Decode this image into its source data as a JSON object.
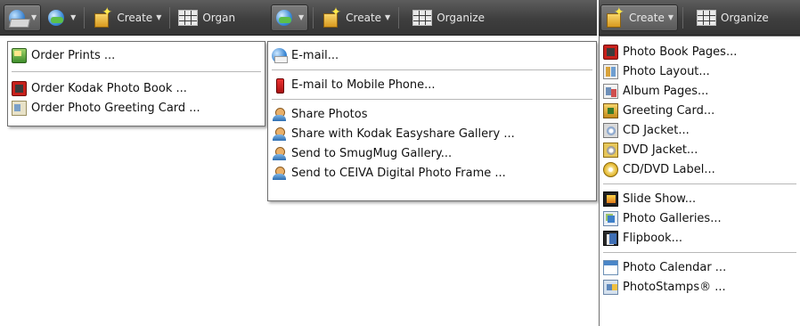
{
  "toolbar1": {
    "share_icon": "share-icon",
    "web_icon": "globe-web-icon",
    "create_label": "Create",
    "organize_label": "Organ"
  },
  "toolbar2": {
    "web_icon": "globe-web-icon",
    "create_label": "Create",
    "organize_label": "Organize"
  },
  "toolbar3": {
    "create_label": "Create",
    "organize_label": "Organize"
  },
  "order_menu": {
    "items": [
      {
        "label": "Order Prints ...",
        "icon": "prints-icon"
      },
      {
        "label": "Order Kodak Photo Book ...",
        "icon": "photo-book-icon"
      },
      {
        "label": "Order Photo Greeting Card ...",
        "icon": "greeting-card-icon"
      }
    ]
  },
  "share_menu": {
    "items": [
      {
        "label": "E-mail...",
        "icon": "email-icon"
      },
      {
        "label": "E-mail to Mobile Phone...",
        "icon": "mobile-phone-icon"
      },
      {
        "label": "Share Photos",
        "icon": "share-people-icon"
      },
      {
        "label": "Share with Kodak Easyshare Gallery ...",
        "icon": "share-people-icon"
      },
      {
        "label": "Send to SmugMug Gallery...",
        "icon": "share-people-icon"
      },
      {
        "label": "Send to CEIVA Digital Photo Frame ...",
        "icon": "share-people-icon"
      }
    ]
  },
  "create_menu": {
    "items": [
      {
        "label": "Photo Book Pages...",
        "icon": "photo-book-pages-icon"
      },
      {
        "label": "Photo Layout...",
        "icon": "photo-layout-icon"
      },
      {
        "label": "Album Pages...",
        "icon": "album-pages-icon"
      },
      {
        "label": "Greeting Card...",
        "icon": "greeting-card-icon"
      },
      {
        "label": "CD Jacket...",
        "icon": "cd-jacket-icon"
      },
      {
        "label": "DVD Jacket...",
        "icon": "dvd-jacket-icon"
      },
      {
        "label": "CD/DVD Label...",
        "icon": "disc-label-icon"
      },
      {
        "label": "Slide Show...",
        "icon": "slide-show-icon"
      },
      {
        "label": "Photo Galleries...",
        "icon": "photo-galleries-icon"
      },
      {
        "label": "Flipbook...",
        "icon": "flipbook-icon"
      },
      {
        "label": "Photo Calendar ...",
        "icon": "calendar-icon"
      },
      {
        "label": "PhotoStamps® ...",
        "icon": "photostamps-icon"
      }
    ]
  }
}
